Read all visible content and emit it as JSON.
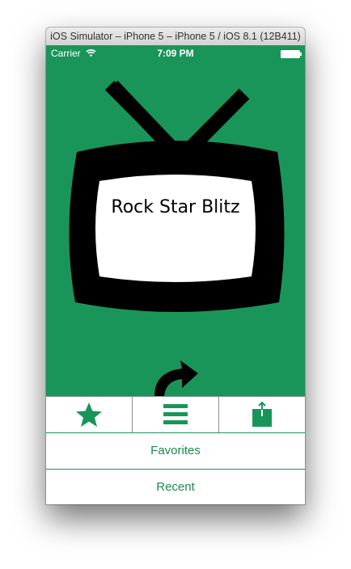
{
  "window": {
    "title": "iOS Simulator – iPhone 5 – iPhone 5 / iOS 8.1 (12B411)"
  },
  "status_bar": {
    "carrier": "Carrier",
    "time": "7:09 PM"
  },
  "tv": {
    "label": "Rock Star Blitz"
  },
  "toolbar": {
    "items": [
      "star-icon",
      "list-icon",
      "share-icon"
    ]
  },
  "menu": {
    "items": [
      {
        "label": "Favorites"
      },
      {
        "label": "Recent"
      }
    ]
  },
  "colors": {
    "accent": "#1a9559",
    "text_green": "#1a8a4f",
    "tv_black": "#000000"
  }
}
